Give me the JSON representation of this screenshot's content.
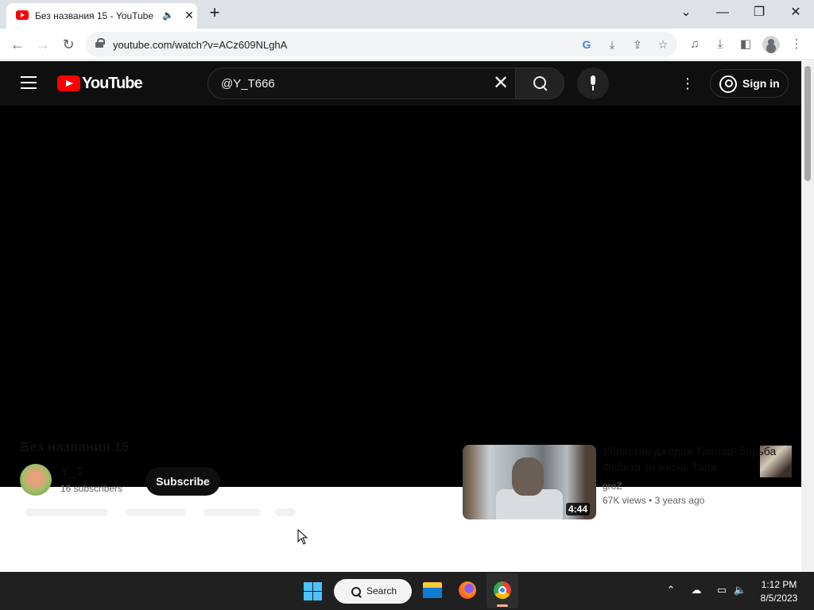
{
  "browser": {
    "tab_title": "Без названия 15 - YouTube",
    "url": "youtube.com/watch?v=ACz609NLghA",
    "tab_audio_icon": "speaker-icon",
    "new_tab_symbol": "+",
    "close_symbol": "✕"
  },
  "youtube": {
    "logo_text": "YouTube",
    "search_value": "@Y_T666",
    "search_clear_symbol": "✕",
    "signin_label": "Sign in",
    "more_symbol": "⋮"
  },
  "video": {
    "title": "Без названия 15",
    "channel_name": "Y_T",
    "subscribers": "16 subscribers",
    "subscribe_label": "Subscribe"
  },
  "recommended": [
    {
      "title": "Убийство джедая Типлар/ борьба Файвза за жизнь Тапа",
      "channel": "groZ",
      "views": "67K views",
      "age": "3 years ago",
      "duration": "4:44"
    }
  ],
  "taskbar": {
    "search_label": "Search",
    "time": "1:12 PM",
    "date": "8/5/2023"
  },
  "colors": {
    "yt_red": "#ff0000",
    "yt_header_bg": "#0f0f0f",
    "taskbar_bg": "#202020"
  }
}
